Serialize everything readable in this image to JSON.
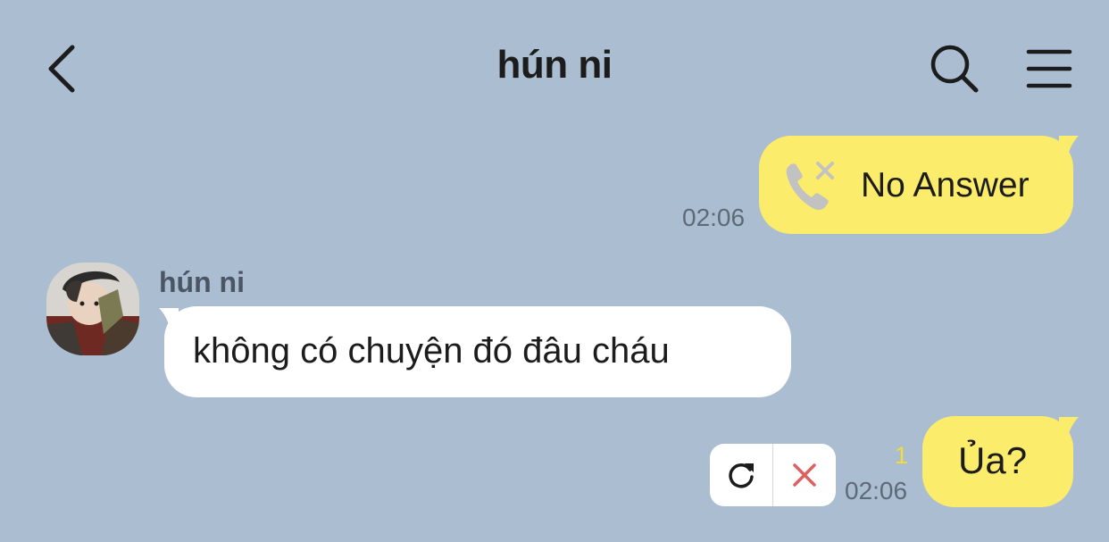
{
  "header": {
    "title": "hún ni",
    "back_icon": "chevron-left-icon",
    "search_icon": "search-icon",
    "menu_icon": "menu-icon"
  },
  "messages": [
    {
      "direction": "outgoing",
      "type": "call",
      "icon": "missed-call-icon",
      "text": "No Answer",
      "time": "02:06"
    },
    {
      "direction": "incoming",
      "sender": "hún ni",
      "text": "không có chuyện đó đâu cháu"
    },
    {
      "direction": "outgoing",
      "type": "text",
      "text": "Ủa?",
      "time": "02:06",
      "unread_count": "1",
      "status": "failed",
      "actions": [
        "retry-icon",
        "delete-icon"
      ]
    }
  ],
  "colors": {
    "background": "#abbdd1",
    "outgoing_bubble": "#fcec6b",
    "incoming_bubble": "#ffffff",
    "unread": "#f3dc3a",
    "delete_red": "#e06060"
  }
}
